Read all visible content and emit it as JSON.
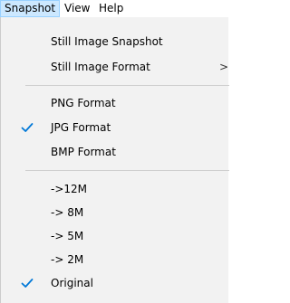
{
  "menubar": {
    "items": [
      {
        "label": "Snapshot",
        "active": true
      },
      {
        "label": "View",
        "active": false
      },
      {
        "label": "Help",
        "active": false
      }
    ]
  },
  "dropdown": {
    "items": [
      {
        "label": "Still Image Snapshot",
        "checked": false
      },
      {
        "label": "Still Image Format",
        "checked": false,
        "submenu_arrow": ">"
      },
      {
        "label": "PNG Format",
        "checked": false
      },
      {
        "label": "JPG Format",
        "checked": true
      },
      {
        "label": "BMP Format",
        "checked": false
      },
      {
        "label": "->12M",
        "checked": false
      },
      {
        "label": "-> 8M",
        "checked": false
      },
      {
        "label": "-> 5M",
        "checked": false
      },
      {
        "label": "-> 2M",
        "checked": false
      },
      {
        "label": "Original",
        "checked": true
      }
    ]
  },
  "colors": {
    "check": "#0078d7",
    "active_menu_bg": "#cce8ff"
  },
  "icons": {
    "check": "check-icon",
    "submenu": "chevron-right-icon"
  }
}
